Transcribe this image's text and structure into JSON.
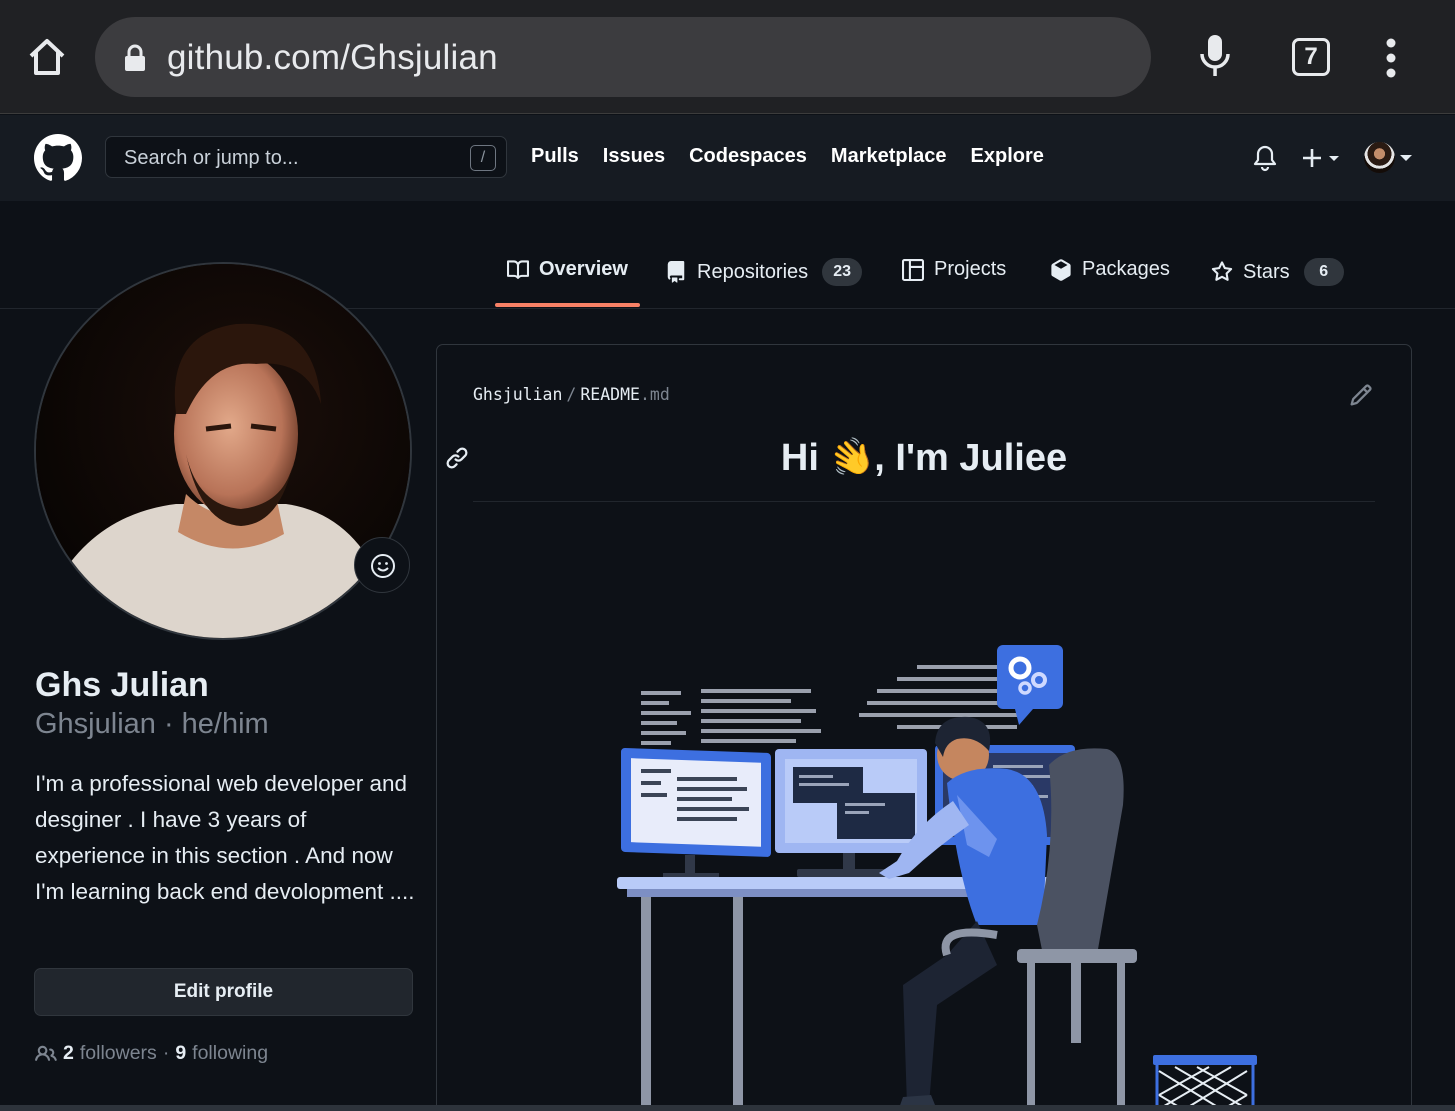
{
  "browser": {
    "url": "github.com/Ghsjulian",
    "tab_count": "7"
  },
  "header": {
    "search_placeholder": "Search or jump to...",
    "search_shortcut": "/",
    "nav": [
      "Pulls",
      "Issues",
      "Codespaces",
      "Marketplace",
      "Explore"
    ]
  },
  "tabs": {
    "overview": "Overview",
    "repositories": "Repositories",
    "repositories_count": "23",
    "projects": "Projects",
    "packages": "Packages",
    "stars": "Stars",
    "stars_count": "6",
    "active": "Overview"
  },
  "profile": {
    "name": "Ghs Julian",
    "login_pronouns": "Ghsjulian · he/him",
    "bio": "I'm a professional web developer and desginer . I have 3 years of experience in this section . And now I'm learning back end devolopment ....",
    "edit_button": "Edit profile",
    "followers_count": "2",
    "followers_label": "followers",
    "following_count": "9",
    "following_label": "following",
    "dot": "·"
  },
  "readme": {
    "owner": "Ghsjulian",
    "separator": "/",
    "file": "README",
    "ext": ".md",
    "heading_pre": "Hi ",
    "heading_emoji": "👋",
    "heading_post": ", I'm Juliee"
  },
  "colors": {
    "accent_tab": "#f78166",
    "bg": "#0d1117",
    "header_bg": "#161b22",
    "illustration_blue": "#3d6fe0"
  }
}
